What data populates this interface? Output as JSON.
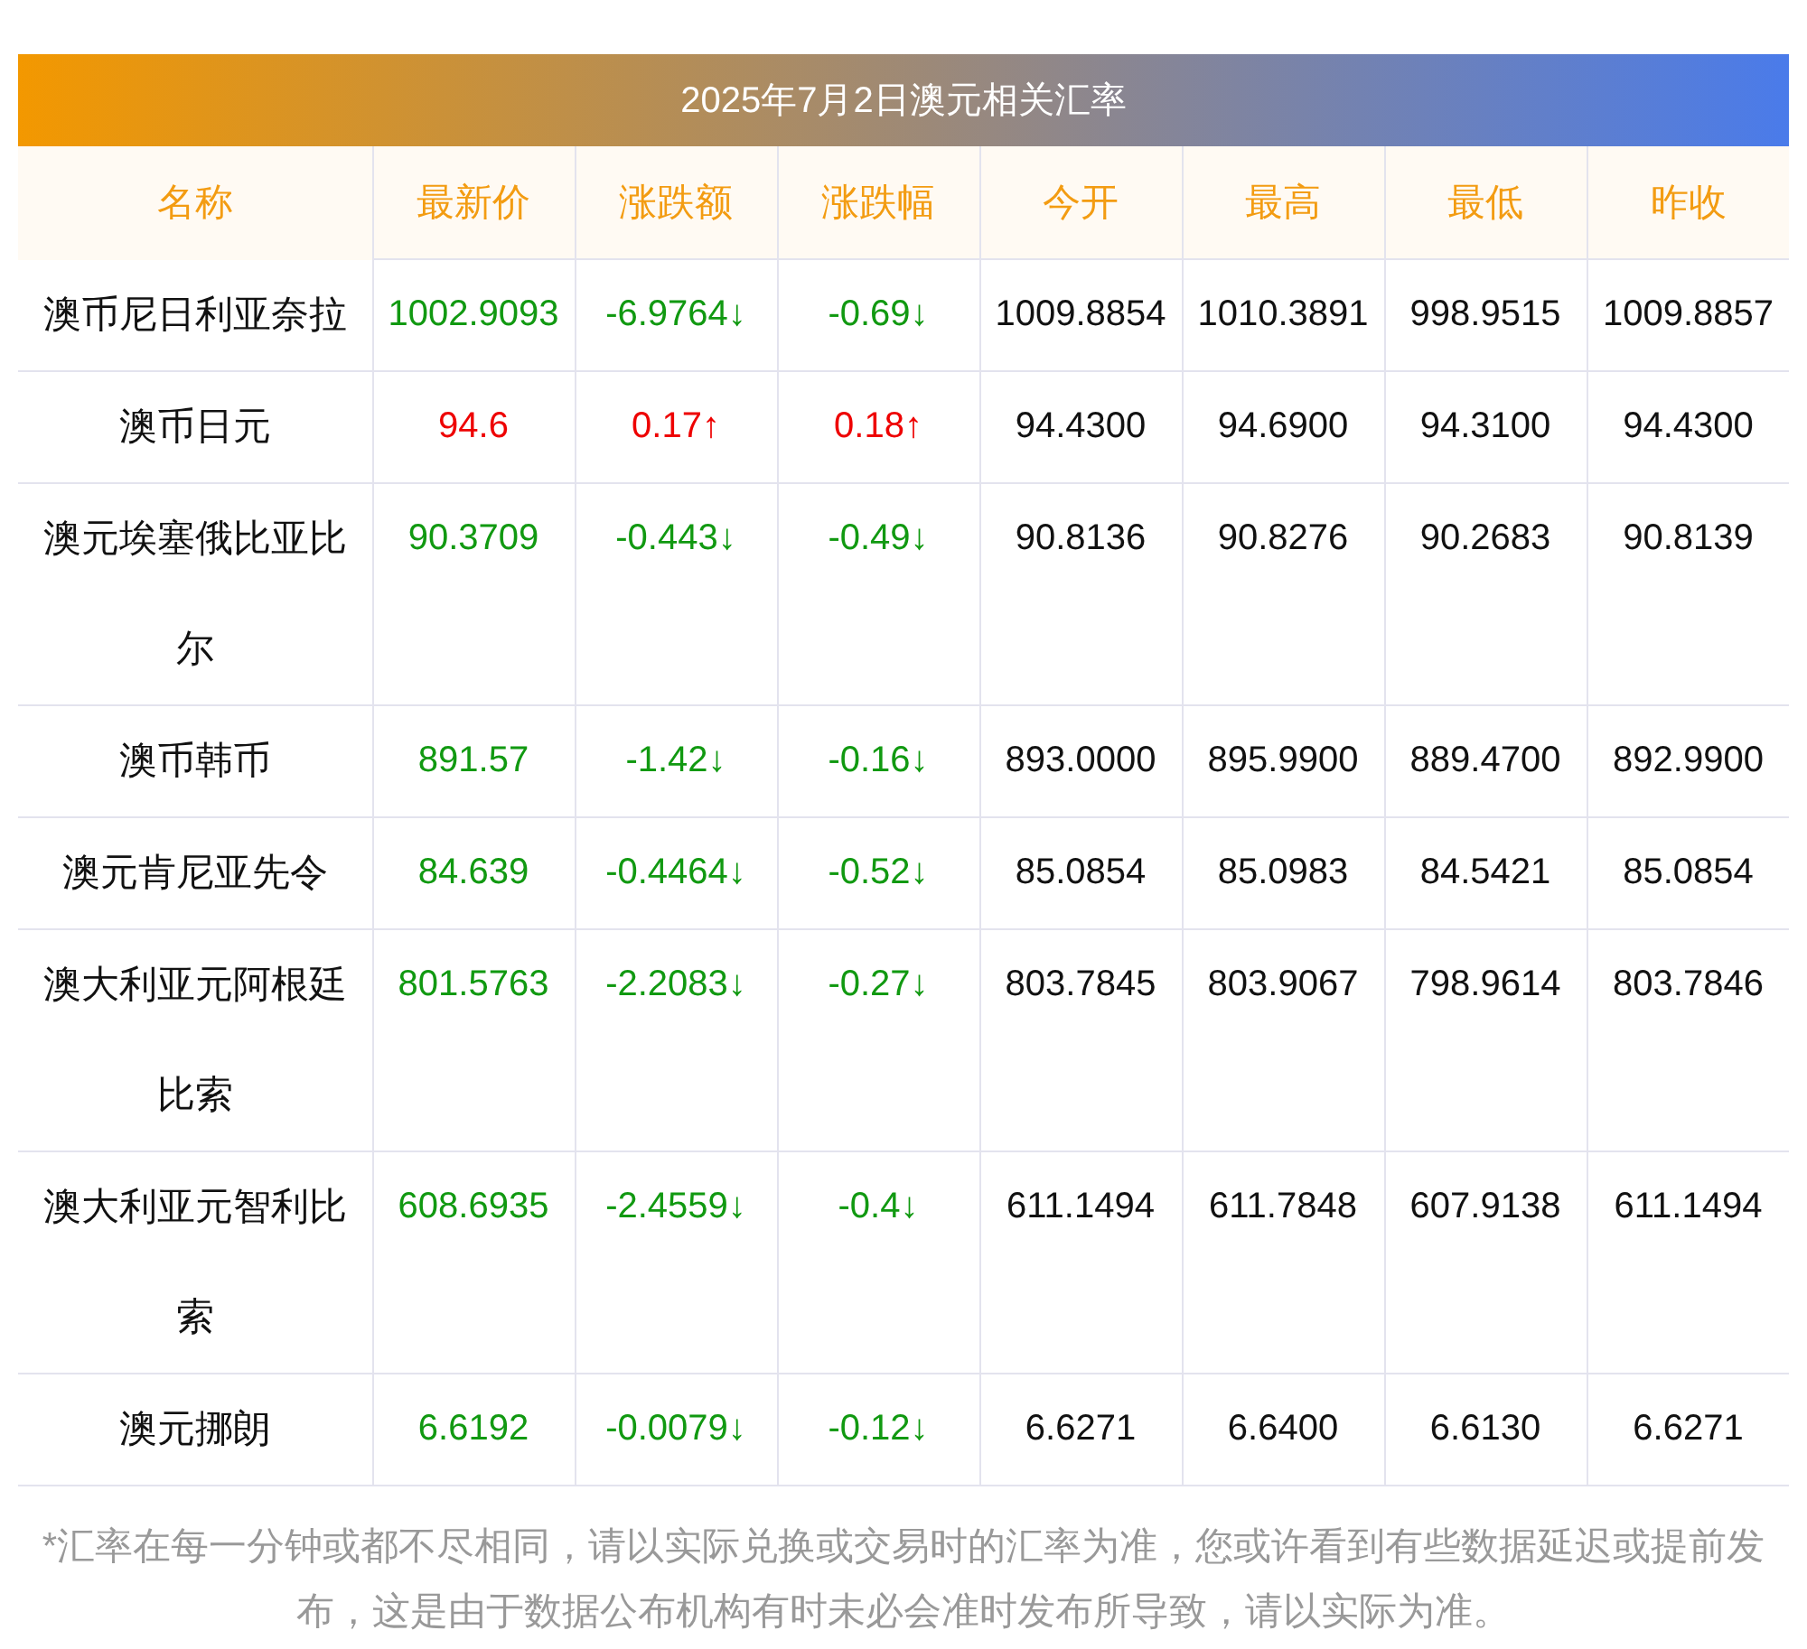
{
  "title": "2025年7月2日澳元相关汇率",
  "table": {
    "columns": [
      "名称",
      "最新价",
      "涨跌额",
      "涨跌幅",
      "今开",
      "最高",
      "最低",
      "昨收"
    ],
    "rows": [
      {
        "kind": "down",
        "cells": [
          "澳币尼日利亚奈拉",
          "1002.9093",
          "-6.9764↓",
          "-0.69↓",
          "1009.8854",
          "1010.3891",
          "998.9515",
          "1009.8857"
        ]
      },
      {
        "kind": "up",
        "cells": [
          "澳币日元",
          "94.6",
          "0.17↑",
          "0.18↑",
          "94.4300",
          "94.6900",
          "94.3100",
          "94.4300"
        ]
      },
      {
        "kind": "down",
        "cells": [
          "澳元埃塞俄比亚比尔",
          "90.3709",
          "-0.443↓",
          "-0.49↓",
          "90.8136",
          "90.8276",
          "90.2683",
          "90.8139"
        ]
      },
      {
        "kind": "down",
        "cells": [
          "澳币韩币",
          "891.57",
          "-1.42↓",
          "-0.16↓",
          "893.0000",
          "895.9900",
          "889.4700",
          "892.9900"
        ]
      },
      {
        "kind": "down",
        "cells": [
          "澳元肯尼亚先令",
          "84.639",
          "-0.4464↓",
          "-0.52↓",
          "85.0854",
          "85.0983",
          "84.5421",
          "85.0854"
        ]
      },
      {
        "kind": "down",
        "cells": [
          "澳大利亚元阿根廷比索",
          "801.5763",
          "-2.2083↓",
          "-0.27↓",
          "803.7845",
          "803.9067",
          "798.9614",
          "803.7846"
        ]
      },
      {
        "kind": "down",
        "cells": [
          "澳大利亚元智利比索",
          "608.6935",
          "-2.4559↓",
          "-0.4↓",
          "611.1494",
          "611.7848",
          "607.9138",
          "611.1494"
        ]
      },
      {
        "kind": "down",
        "cells": [
          "澳元挪朗",
          "6.6192",
          "-0.0079↓",
          "-0.12↓",
          "6.6271",
          "6.6400",
          "6.6130",
          "6.6271"
        ]
      }
    ]
  },
  "note": "*汇率在每一分钟或都不尽相同，请以实际兑换或交易时的汇率为准，您或许看到有些数据延迟或提前发布，这是由于数据公布机构有时未必会准时发布所导致，请以实际为准。"
}
